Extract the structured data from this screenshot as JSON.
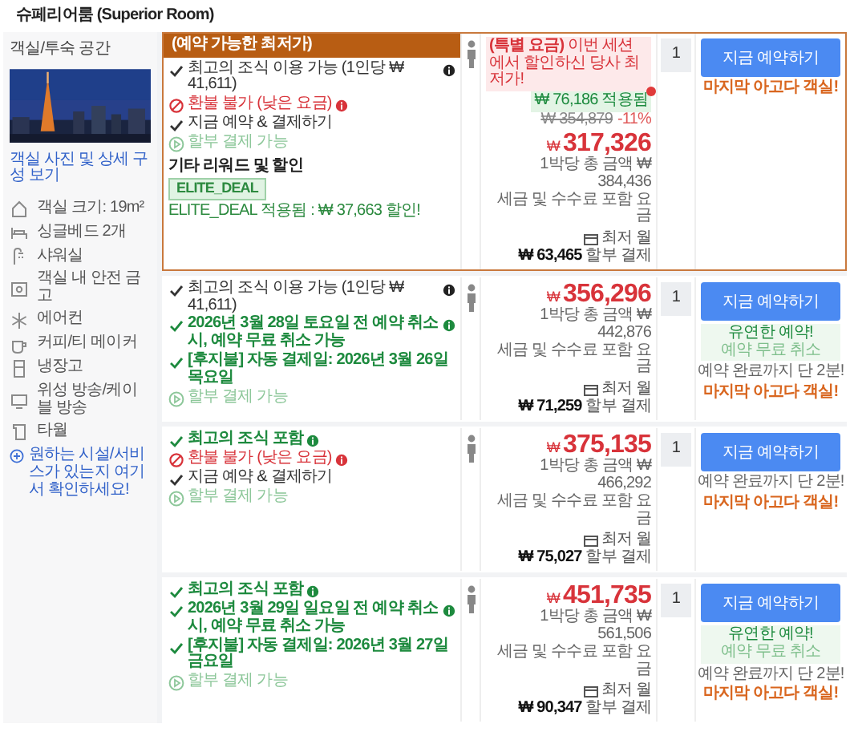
{
  "room": {
    "title": "슈페리어룸 (Superior Room)"
  },
  "sidebar": {
    "heading": "객실/투숙 공간",
    "photo_link": "객실 사진 및 상세 구성 보기",
    "amenities": [
      {
        "kind": "size",
        "label": "객실 크기: 19m²"
      },
      {
        "kind": "bed",
        "label": "싱글베드 2개"
      },
      {
        "kind": "shower",
        "label": "샤워실"
      },
      {
        "kind": "safe",
        "label": "객실 내 안전 금고"
      },
      {
        "kind": "ac",
        "label": "에어컨"
      },
      {
        "kind": "coffee",
        "label": "커피/티 메이커"
      },
      {
        "kind": "fridge",
        "label": "냉장고"
      },
      {
        "kind": "tv",
        "label": "위성 방송/케이블 방송"
      },
      {
        "kind": "towel",
        "label": "타월"
      }
    ],
    "help_link": "원하는 시설/서비스가 있는지 여기서 확인하세요!"
  },
  "offers": [
    {
      "highlighted": true,
      "banner": "(예약 가능한 최저가)",
      "features": [
        {
          "kind": "check",
          "text": "최고의 조식 이용 가능 (1인당 ₩ 41,611)",
          "info": true
        },
        {
          "kind": "no-refund",
          "text": "환불 불가 (낮은 요금)",
          "info": true
        },
        {
          "kind": "check",
          "text": "지금 예약 & 결제하기",
          "info": false
        },
        {
          "kind": "installment",
          "text": "할부 결제 가능",
          "info": false
        }
      ],
      "rewards": {
        "title": "기타 리워드 및 할인",
        "tag": "ELITE_DEAL",
        "text": "ELITE_DEAL 적용됨 : ₩ 37,663 할인!"
      },
      "price": {
        "promo": "**(특별 요금)** 이번 세션에서 할인하신 당사 최저가!",
        "applied": "₩ 76,186 적용됨",
        "original": "₩ 354,879",
        "discount": "-11%",
        "currency": "₩",
        "amount": "317,326",
        "total": "1박당 총 금액 ₩ 384,436",
        "tax": "세금 및 수수료 포함 요금",
        "monthly_label": "최저 월",
        "monthly": "**₩ 63,465** 할부 결제"
      },
      "quantity": "1",
      "button": "지금 예약하기",
      "notes": [
        {
          "kind": "last",
          "text": "마지막 아고다 객실!"
        }
      ]
    },
    {
      "highlighted": false,
      "features": [
        {
          "kind": "check",
          "text": "최고의 조식 이용 가능 (1인당 ₩ 41,611)",
          "info": true
        },
        {
          "kind": "check-green",
          "text": "2026년 3월 28일 토요일 전 예약 취소 시, 예약 무료 취소 가능",
          "info": true
        },
        {
          "kind": "check-green",
          "text": "[후지불] 자동 결제일: 2026년 3월 26일 목요일",
          "info": false
        },
        {
          "kind": "installment",
          "text": "할부 결제 가능",
          "info": false
        }
      ],
      "price": {
        "currency": "₩",
        "amount": "356,296",
        "total": "1박당 총 금액 ₩ 442,876",
        "tax": "세금 및 수수료 포함 요금",
        "monthly_label": "최저 월",
        "monthly": "**₩ 71,259** 할부 결제"
      },
      "quantity": "1",
      "button": "지금 예약하기",
      "notes": [
        {
          "kind": "flexible",
          "text": "유연한 예약!",
          "sub": "예약 무료 취소"
        },
        {
          "kind": "urgency",
          "text": "예약 완료까지 단 2분!"
        },
        {
          "kind": "last",
          "text": "마지막 아고다 객실!"
        }
      ]
    },
    {
      "highlighted": false,
      "features": [
        {
          "kind": "check-green",
          "text": "최고의 조식 포함",
          "info": true
        },
        {
          "kind": "no-refund",
          "text": "환불 불가 (낮은 요금)",
          "info": true
        },
        {
          "kind": "check",
          "text": "지금 예약 & 결제하기",
          "info": false
        },
        {
          "kind": "installment",
          "text": "할부 결제 가능",
          "info": false
        }
      ],
      "price": {
        "currency": "₩",
        "amount": "375,135",
        "total": "1박당 총 금액 ₩ 466,292",
        "tax": "세금 및 수수료 포함 요금",
        "monthly_label": "최저 월",
        "monthly": "**₩ 75,027** 할부 결제"
      },
      "quantity": "1",
      "button": "지금 예약하기",
      "notes": [
        {
          "kind": "urgency",
          "text": "예약 완료까지 단 2분!"
        },
        {
          "kind": "last",
          "text": "마지막 아고다 객실!"
        }
      ]
    },
    {
      "highlighted": false,
      "features": [
        {
          "kind": "check-green",
          "text": "최고의 조식 포함",
          "info": true
        },
        {
          "kind": "check-green",
          "text": "2026년 3월 29일 일요일 전 예약 취소 시, 예약 무료 취소 가능",
          "info": true
        },
        {
          "kind": "check-green",
          "text": "[후지불] 자동 결제일: 2026년 3월 27일 금요일",
          "info": false
        },
        {
          "kind": "installment",
          "text": "할부 결제 가능",
          "info": false
        }
      ],
      "price": {
        "currency": "₩",
        "amount": "451,735",
        "total": "1박당 총 금액 ₩ 561,506",
        "tax": "세금 및 수수료 포함 요금",
        "monthly_label": "최저 월",
        "monthly": "**₩ 90,347** 할부 결제"
      },
      "quantity": "1",
      "button": "지금 예약하기",
      "notes": [
        {
          "kind": "flexible",
          "text": "유연한 예약!",
          "sub": "예약 무료 취소"
        },
        {
          "kind": "urgency",
          "text": "예약 완료까지 단 2분!"
        },
        {
          "kind": "last",
          "text": "마지막 아고다 객실!"
        }
      ]
    }
  ]
}
